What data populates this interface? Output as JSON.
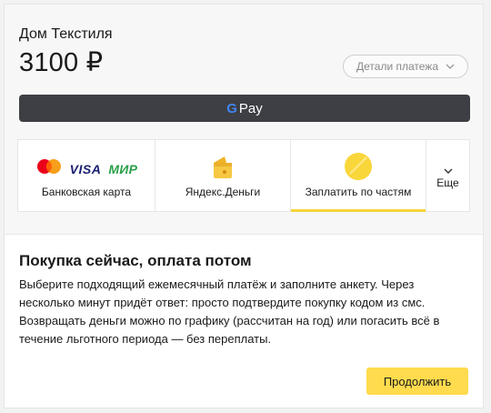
{
  "merchant": {
    "name": "Дом Текстиля"
  },
  "amount": {
    "value": "3100 ₽"
  },
  "details": {
    "label": "Детали платежа"
  },
  "gpay": {
    "g": "G",
    "label": "Pay"
  },
  "methods": [
    {
      "label": "Банковская карта",
      "logos": {
        "visa": "VISA",
        "mir": "МИР"
      }
    },
    {
      "label": "Яндекс.Деньги"
    },
    {
      "label": "Заплатить по частям",
      "active": true
    },
    {
      "label": "Еще"
    }
  ],
  "content": {
    "title": "Покупка сейчас, оплата потом",
    "description": "Выберите подходящий ежемесячный платёж и заполните анкету. Через несколько минут придёт ответ: просто подтвердите покупку кодом из смс. Возвращать деньги можно по графику (рассчитан на год) или погасить всё в течение льготного периода — без переплаты."
  },
  "continue": {
    "label": "Продолжить"
  },
  "colors": {
    "accent": "#f6d43b",
    "button": "#ffdb4d",
    "gpay": "#3d3f44"
  }
}
